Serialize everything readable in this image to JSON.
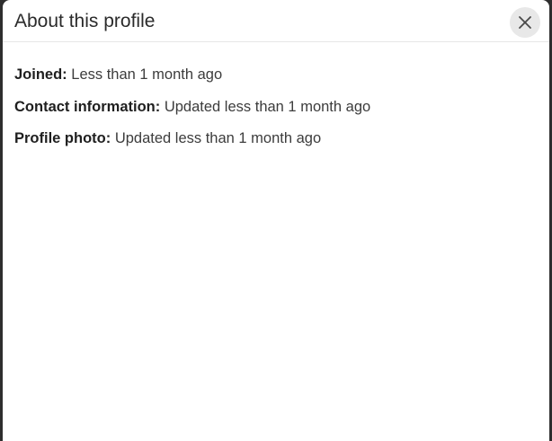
{
  "modal": {
    "title": "About this profile",
    "close_icon": "close-x-icon"
  },
  "details": [
    {
      "label": "Joined:",
      "value": "Less than 1 month ago"
    },
    {
      "label": "Contact information:",
      "value": "Updated less than 1 month ago"
    },
    {
      "label": "Profile photo:",
      "value": "Updated less than 1 month ago"
    }
  ]
}
